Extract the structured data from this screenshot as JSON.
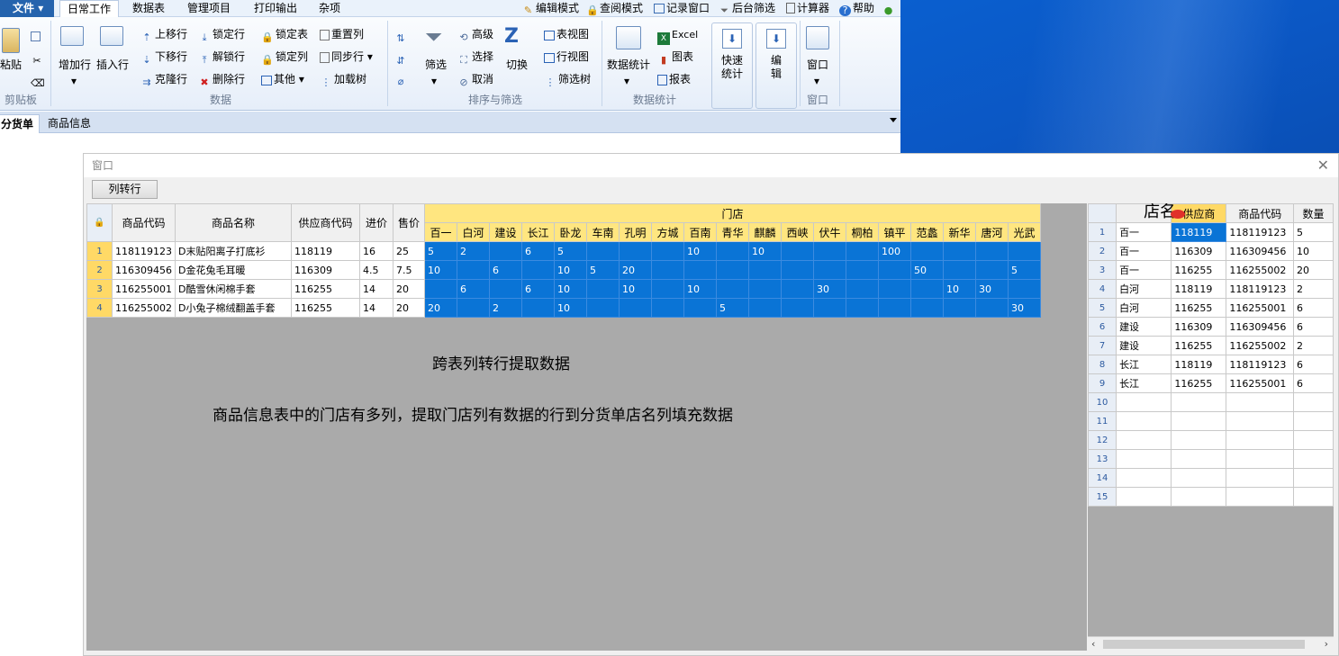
{
  "menu": {
    "file": "文件",
    "tabs": [
      "日常工作",
      "数据表",
      "管理项目",
      "打印输出",
      "杂项"
    ],
    "quick": [
      {
        "label": "编辑模式",
        "icon": "pencil-icon"
      },
      {
        "label": "查阅模式",
        "icon": "lock-icon"
      },
      {
        "label": "记录窗口",
        "icon": "window-icon"
      },
      {
        "label": "后台筛选",
        "icon": "funnel-icon"
      },
      {
        "label": "计算器",
        "icon": "calculator-icon"
      },
      {
        "label": "帮助",
        "icon": "help-icon"
      }
    ]
  },
  "ribbon": {
    "clipboard": {
      "paste": "粘贴",
      "group": "剪贴板"
    },
    "data": {
      "add_row": "增加行",
      "insert_row": "插入行",
      "move_up": "上移行",
      "move_down": "下移行",
      "clone_row": "克隆行",
      "lock_row": "锁定行",
      "unlock_row": "解锁行",
      "delete_row": "删除行",
      "lock_table": "锁定表",
      "lock_col": "锁定列",
      "other": "其他",
      "reset_col": "重置列",
      "sync_row": "同步行",
      "load_tree": "加载树",
      "group": "数据"
    },
    "sort": {
      "filter": "筛选",
      "advanced": "高级",
      "select": "选择",
      "cancel": "取消",
      "toggle": "切换",
      "group": "排序与筛选"
    },
    "views": {
      "table_view": "表视图",
      "row_view": "行视图",
      "filter_tree": "筛选树"
    },
    "stats": {
      "excel": "Excel",
      "chart": "图表",
      "report": "报表",
      "data_stats": "数据统计",
      "quick_stats": "快速\n统计",
      "edit": "编\n辑",
      "window": "窗口",
      "group": "数据统计",
      "group2": "窗口"
    }
  },
  "doc_tabs": [
    "分货单",
    "商品信息"
  ],
  "window": {
    "title": "窗口",
    "convert_button": "列转行"
  },
  "left_grid": {
    "headers": [
      "商品代码",
      "商品名称",
      "供应商代码",
      "进价",
      "售价"
    ],
    "store_group": "门店",
    "stores": [
      "百一",
      "白河",
      "建设",
      "长江",
      "卧龙",
      "车南",
      "孔明",
      "方城",
      "百南",
      "青华",
      "麒麟",
      "西峡",
      "伏牛",
      "桐柏",
      "镇平",
      "范蠡",
      "新华",
      "唐河",
      "光武"
    ],
    "rows": [
      {
        "n": "1",
        "code": "118119123",
        "name": "D末贴阳离子打底衫",
        "sup": "118119",
        "cost": "16",
        "price": "25",
        "vals": [
          "5",
          "2",
          "",
          "6",
          "5",
          "",
          "",
          "",
          "10",
          "",
          "10",
          "",
          "",
          "",
          "100",
          "",
          "",
          "",
          ""
        ]
      },
      {
        "n": "2",
        "code": "116309456",
        "name": "D金花兔毛耳暖",
        "sup": "116309",
        "cost": "4.5",
        "price": "7.5",
        "vals": [
          "10",
          "",
          "6",
          "",
          "10",
          "5",
          "20",
          "",
          "",
          "",
          "",
          "",
          "",
          "",
          "",
          "50",
          "",
          "",
          "5"
        ]
      },
      {
        "n": "3",
        "code": "116255001",
        "name": "D酷雪休闲棉手套",
        "sup": "116255",
        "cost": "14",
        "price": "20",
        "vals": [
          "",
          "6",
          "",
          "6",
          "10",
          "",
          "10",
          "",
          "10",
          "",
          "",
          "",
          "30",
          "",
          "",
          "",
          "10",
          "30",
          ""
        ]
      },
      {
        "n": "4",
        "code": "116255002",
        "name": "D小兔子棉绒翻盖手套",
        "sup": "116255",
        "cost": "14",
        "price": "20",
        "vals": [
          "20",
          "",
          "2",
          "",
          "10",
          "",
          "",
          "",
          "",
          "5",
          "",
          "",
          "",
          "",
          "",
          "",
          "",
          "",
          "30"
        ]
      }
    ]
  },
  "annotations": {
    "title": "跨表列转行提取数据",
    "desc": "商品信息表中的门店有多列，提取门店列有数据的行到分货单店名列填充数据"
  },
  "right_grid": {
    "headers": [
      "店名",
      "供应商",
      "商品代码",
      "数量"
    ],
    "rows": [
      {
        "n": "1",
        "shop": "百一",
        "sup": "118119",
        "code": "118119123",
        "qty": "5"
      },
      {
        "n": "2",
        "shop": "百一",
        "sup": "116309",
        "code": "116309456",
        "qty": "10"
      },
      {
        "n": "3",
        "shop": "百一",
        "sup": "116255",
        "code": "116255002",
        "qty": "20"
      },
      {
        "n": "4",
        "shop": "白河",
        "sup": "118119",
        "code": "118119123",
        "qty": "2"
      },
      {
        "n": "5",
        "shop": "白河",
        "sup": "116255",
        "code": "116255001",
        "qty": "6"
      },
      {
        "n": "6",
        "shop": "建设",
        "sup": "116309",
        "code": "116309456",
        "qty": "6"
      },
      {
        "n": "7",
        "shop": "建设",
        "sup": "116255",
        "code": "116255002",
        "qty": "2"
      },
      {
        "n": "8",
        "shop": "长江",
        "sup": "118119",
        "code": "118119123",
        "qty": "6"
      },
      {
        "n": "9",
        "shop": "长江",
        "sup": "116255",
        "code": "116255001",
        "qty": "6"
      },
      {
        "n": "10",
        "shop": "",
        "sup": "",
        "code": "",
        "qty": ""
      },
      {
        "n": "11",
        "shop": "",
        "sup": "",
        "code": "",
        "qty": ""
      },
      {
        "n": "12",
        "shop": "",
        "sup": "",
        "code": "",
        "qty": ""
      },
      {
        "n": "13",
        "shop": "",
        "sup": "",
        "code": "",
        "qty": ""
      },
      {
        "n": "14",
        "shop": "",
        "sup": "",
        "code": "",
        "qty": ""
      },
      {
        "n": "15",
        "shop": "",
        "sup": "",
        "code": "",
        "qty": ""
      }
    ]
  },
  "colors": {
    "accent": "#0a74d6",
    "header_yellow": "#ffe680",
    "arrow": "#e0302a"
  }
}
